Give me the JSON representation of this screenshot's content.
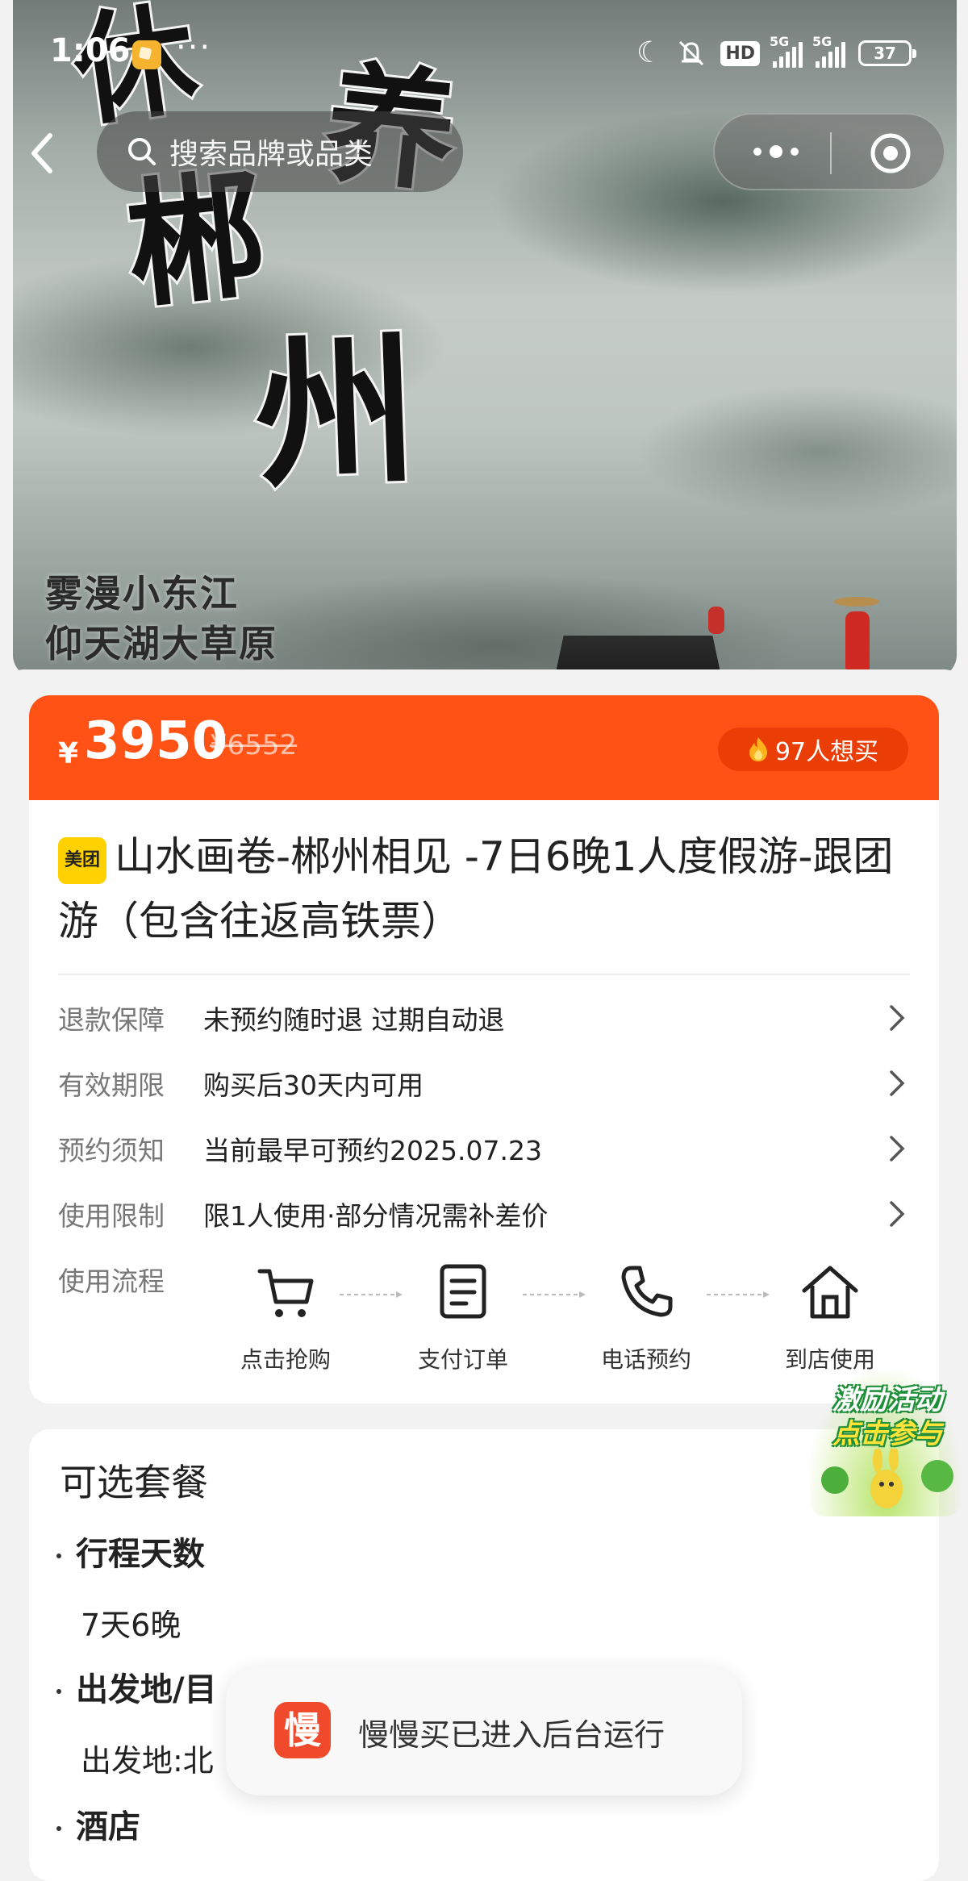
{
  "status_bar": {
    "time": "1:06",
    "overflow_dots": "···",
    "hd_label": "HD",
    "signal_1_label": "5G",
    "signal_2_label": "5G",
    "battery": "37",
    "icons": [
      "moon-icon",
      "mute-icon",
      "hd-icon",
      "signal-icon",
      "signal-icon",
      "battery-icon"
    ]
  },
  "nav": {
    "search_placeholder": "搜索品牌或品类"
  },
  "hero": {
    "callig_1": "休",
    "callig_2": "郴",
    "callig_3": "养",
    "callig_4": "州",
    "poem_line_1": "雾漫小东江",
    "poem_line_2": "仰天湖大草原"
  },
  "price": {
    "currency": "¥",
    "current": "3950",
    "original": "¥6552",
    "want_count": "97人想买"
  },
  "product": {
    "badge": "美团",
    "title": "山水画卷-郴州相见 -7日6晚1人度假游-跟团游（包含往返高铁票）"
  },
  "info_rows": [
    {
      "label": "退款保障",
      "value": "未预约随时退 过期自动退"
    },
    {
      "label": "有效期限",
      "value": "购买后30天内可用"
    },
    {
      "label": "预约须知",
      "value": "当前最早可预约2025.07.23"
    },
    {
      "label": "使用限制",
      "value": "限1人使用·部分情况需补差价"
    }
  ],
  "flow": {
    "label": "使用流程",
    "steps": [
      {
        "label": "点击抢购",
        "icon": "cart-icon"
      },
      {
        "label": "支付订单",
        "icon": "order-icon"
      },
      {
        "label": "电话预约",
        "icon": "phone-icon"
      },
      {
        "label": "到店使用",
        "icon": "home-icon"
      }
    ]
  },
  "package": {
    "title": "可选套餐",
    "sections": [
      {
        "name": "行程天数",
        "value": "7天6晚"
      },
      {
        "name": "出发地/目",
        "value": "出发地:北"
      },
      {
        "name": "酒店",
        "value": ""
      }
    ]
  },
  "promo": {
    "line_1": "激励活动",
    "line_2": "点击参与"
  },
  "toast": {
    "icon_char": "慢",
    "text": "慢慢买已进入后台运行"
  },
  "colors": {
    "price_bar": "#ff5214",
    "want_pill": "#ea3e06",
    "badge": "#ffd100",
    "toast_icon": "#f04a2c"
  }
}
